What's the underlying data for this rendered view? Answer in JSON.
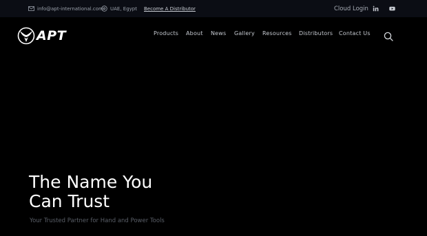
{
  "topbar": {
    "email": "info@apt-international.com",
    "location": "UAE, Egypt",
    "distributor_link": "Become A Distributor",
    "cloud_login": "Cloud Login",
    "icons": {
      "email": "mail-icon",
      "location": "location-pin-icon",
      "linkedin": "linkedin-icon",
      "youtube": "youtube-icon"
    }
  },
  "brand": {
    "logo_text": "APT",
    "icon": "apt-logo-icon"
  },
  "nav": {
    "items": [
      "Products",
      "About",
      "News",
      "Gallery",
      "Resources",
      "Distributors",
      "Contact Us"
    ],
    "search_icon": "search-icon"
  },
  "hero": {
    "title_line1": "The Name You",
    "title_line2": "Can Trust",
    "subtitle": "Your Trusted Partner for Hand and Power Tools"
  },
  "colors": {
    "background": "#000000",
    "topbar": "#0b0d14",
    "text_primary": "#ffffff",
    "text_muted": "#9aa0aa",
    "subtitle": "#5a5f68"
  }
}
